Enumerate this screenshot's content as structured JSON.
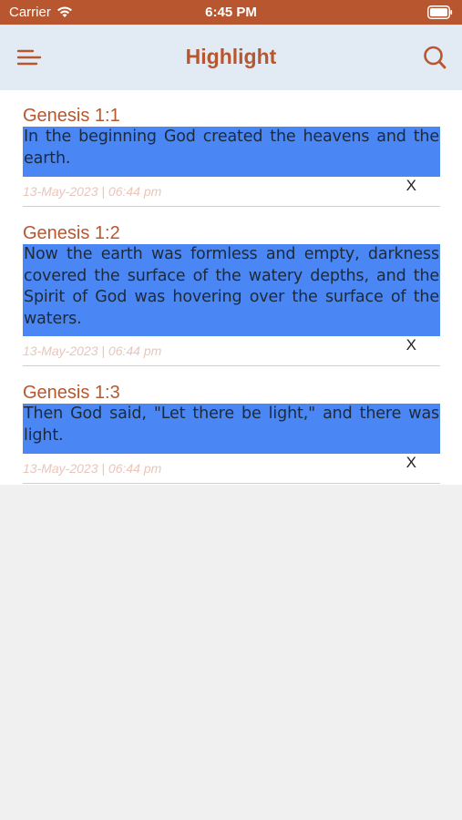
{
  "status": {
    "carrier": "Carrier",
    "time": "6:45 PM"
  },
  "nav": {
    "title": "Highlight",
    "menu_icon": "menu-icon",
    "search_icon": "search-icon"
  },
  "colors": {
    "accent": "#b8562f",
    "header_bg": "#e2ebf3",
    "highlight": "#4a87f4",
    "date_text": "#e8c6ba"
  },
  "highlights": [
    {
      "reference": "Genesis 1:1",
      "text": "In the beginning God created the heavens and the earth.",
      "date": "13-May-2023 | 06:44 pm",
      "delete_label": "X"
    },
    {
      "reference": "Genesis 1:2",
      "text": "Now the earth was formless and empty, darkness covered the surface of the watery depths, and the Spirit of God was hovering over the surface of the waters.",
      "date": "13-May-2023 | 06:44 pm",
      "delete_label": "X"
    },
    {
      "reference": "Genesis 1:3",
      "text": "Then God said, \"Let there be light,\" and there was light.",
      "date": "13-May-2023 | 06:44 pm",
      "delete_label": "X"
    }
  ]
}
